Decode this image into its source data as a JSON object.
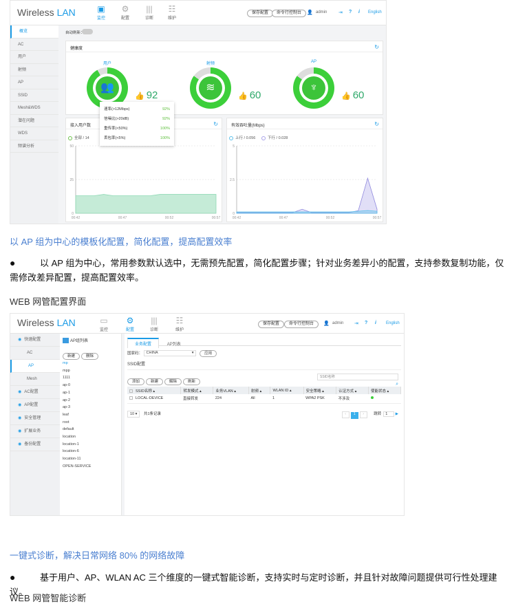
{
  "monitor": {
    "logo": {
      "a": "Wireless ",
      "b": "LAN"
    },
    "nav": [
      {
        "label": "监控",
        "icon": "monitor-icon"
      },
      {
        "label": "配置",
        "icon": "gear-icon"
      },
      {
        "label": "诊断",
        "icon": "sliders-icon"
      },
      {
        "label": "维护",
        "icon": "maintenance-icon"
      }
    ],
    "save_config": "保存配置",
    "cli_console": "命令行控制台",
    "user": "admin",
    "help": "?",
    "info": "i",
    "language": "English",
    "sidebar": [
      "概览",
      "AC",
      "用户",
      "射频",
      "AP",
      "SSID",
      "Mesh&WDS",
      "潜在问题",
      "WDS",
      "频谱分析"
    ],
    "auto_refresh": "自动刷新：",
    "health": {
      "title": "健康度",
      "items": [
        {
          "label": "用户",
          "score": "92",
          "percent": 92,
          "icon": "users-icon"
        },
        {
          "label": "射频",
          "score": "60",
          "percent": 85,
          "icon": "wifi-icon"
        },
        {
          "label": "AP",
          "score": "60",
          "percent": 85,
          "icon": "antenna-icon"
        }
      ]
    },
    "tooltip": [
      {
        "k": "速率(>12Mbps)",
        "v": "92%"
      },
      {
        "k": "信噪比(>20dB)",
        "v": "92%"
      },
      {
        "k": "重传率(<50%)",
        "v": "100%"
      },
      {
        "k": "丢包率(<5%)",
        "v": "100%"
      }
    ],
    "colors": {
      "accent": "#1a9be6",
      "good": "#3ccf3a",
      "users_area": "#bfe9d3",
      "up": "#5bc0ea",
      "down": "#a9a3e8"
    }
  },
  "chart_data": [
    {
      "type": "area",
      "title": "接入用户数",
      "legend": [
        {
          "name": "全部 / 14"
        }
      ],
      "x": [
        "00:42",
        "00:43",
        "00:44",
        "00:45",
        "00:46",
        "00:47",
        "00:48",
        "00:49",
        "00:50",
        "00:51",
        "00:52",
        "00:53",
        "00:54",
        "00:55",
        "00:56",
        "00:57"
      ],
      "xticks": [
        "00:42",
        "00:47",
        "00:52",
        "00:57"
      ],
      "yticks": [
        "0",
        "25",
        "50"
      ],
      "ylim": [
        0,
        50
      ],
      "series": [
        {
          "name": "全部",
          "values": [
            13,
            13,
            13,
            14,
            13,
            13,
            13,
            13,
            13,
            14,
            14,
            14,
            14,
            14,
            14,
            14
          ]
        }
      ]
    },
    {
      "type": "area",
      "title": "有效吞吐量(Mbps)",
      "legend": [
        {
          "name": "上行 / 0.056"
        },
        {
          "name": "下行 / 0.028"
        }
      ],
      "x": [
        "00:42",
        "00:43",
        "00:44",
        "00:45",
        "00:46",
        "00:47",
        "00:48",
        "00:49",
        "00:50",
        "00:51",
        "00:52",
        "00:53",
        "00:54",
        "00:55",
        "00:56",
        "00:57"
      ],
      "xticks": [
        "00:42",
        "00:47",
        "00:52",
        "00:57"
      ],
      "yticks": [
        "0",
        "2.5",
        "5"
      ],
      "ylim": [
        0,
        5
      ],
      "series": [
        {
          "name": "上行",
          "values": [
            0.1,
            0.1,
            0.1,
            0.1,
            0.1,
            0.1,
            0.1,
            0.1,
            0.1,
            0.1,
            0.1,
            0.1,
            0.1,
            0.15,
            0.2,
            0.15
          ]
        },
        {
          "name": "下行",
          "values": [
            0.05,
            0.05,
            0.05,
            0.05,
            0.05,
            0.05,
            0.05,
            0.3,
            0.05,
            0.05,
            0.05,
            0.05,
            0.05,
            0.2,
            2.6,
            0.3
          ]
        }
      ]
    }
  ],
  "text1": {
    "heading": "以 AP 组为中心的模板化配置，简化配置，提高配置效率",
    "bullet": "以 AP 组为中心，常用参数默认选中，无需预先配置，简化配置步骤；针对业务差异小的配置，支持参数复制功能，仅需修改差异配置，提高配置效率。",
    "caption": "WEB 网管配置界面"
  },
  "config": {
    "sidebar": [
      {
        "label": "快速配置",
        "dot": true
      },
      {
        "label": "AC"
      },
      {
        "label": "AP",
        "active": true
      },
      {
        "label": "Mesh"
      },
      {
        "label": "AC配置",
        "dot": true
      },
      {
        "label": "AP配置",
        "dot": true
      },
      {
        "label": "安全管理",
        "dot": true
      },
      {
        "label": "扩展业务",
        "dot": true
      },
      {
        "label": "备份配置",
        "dot": true
      }
    ],
    "ap_group_title": "AP组列表",
    "new": "新建",
    "delete": "删除",
    "ap_groups": [
      "mp",
      "mpp",
      "1111",
      "ap-0",
      "ap-1",
      "ap-2",
      "ap-3",
      "leaf",
      "root",
      "default",
      "location",
      "location-1",
      "location-6",
      "location-11",
      "OPEN-SERVICE"
    ],
    "tabs": [
      "业务配置",
      "AP列表"
    ],
    "country_label": "国家码：",
    "country_value": "CHINA",
    "apply": "应用",
    "ssid_title": "SSID配置",
    "actions": [
      "添加",
      "新建",
      "解除",
      "刷新"
    ],
    "search_placeholder": "SSID名称",
    "columns": [
      "SSID名称",
      "转发模式",
      "业务VLAN",
      "射频",
      "WLAN ID",
      "安全策略",
      "认证方式",
      "使能状态"
    ],
    "rows": [
      [
        "LOCAL-DEVICE",
        "直接转发",
        "224",
        "All",
        "1",
        "WPA2 PSK",
        "不涉及",
        "enabled"
      ]
    ],
    "page_size": "10",
    "total": "共1条记录",
    "page": "1",
    "jump": "跳转",
    "jump_value": "1"
  },
  "text2": {
    "heading": "一键式诊断，解决日常网络  80%  的网络故障",
    "bullet": "基于用户、AP、WLAN AC 三个维度的一键式智能诊断，支持实时与定时诊断，并且针对故障问题提供可行性处理建议。",
    "caption": "WEB 网管智能诊断"
  }
}
